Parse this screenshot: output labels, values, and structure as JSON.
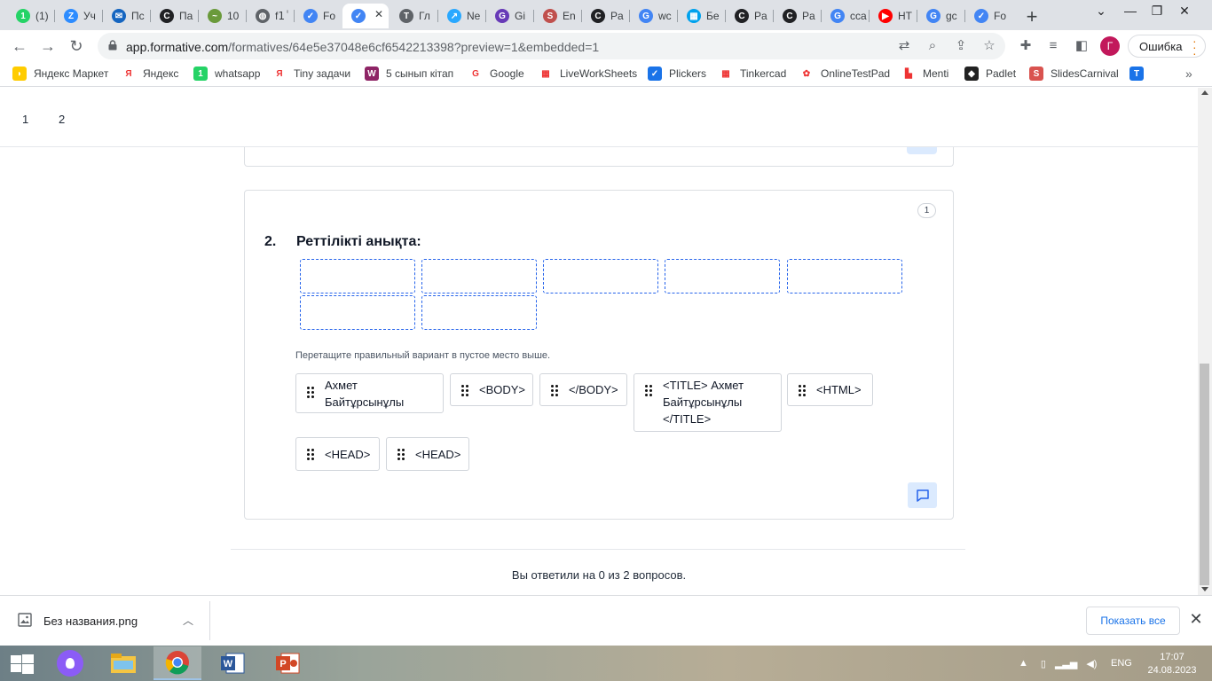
{
  "colors": {
    "accent": "#2563eb",
    "comment_bg": "#dbeafe",
    "profile": "#c2185b",
    "error_dots": "#e37400",
    "show_all": "#1a73e8"
  },
  "tabs": [
    {
      "label": "(1)",
      "icon": "whatsapp-icon",
      "color": "#25d366",
      "glyph": "1"
    },
    {
      "label": "Уч",
      "icon": "zoom-icon",
      "color": "#2d8cff",
      "glyph": "Z"
    },
    {
      "label": "Пс",
      "icon": "mail-icon",
      "color": "#1565c0",
      "glyph": "✉"
    },
    {
      "label": "Па",
      "icon": "padlet-icon",
      "color": "#202124",
      "glyph": "C"
    },
    {
      "label": "10",
      "icon": "site-icon",
      "color": "#6a9a3b",
      "glyph": "~"
    },
    {
      "label": "f1ٰ",
      "icon": "globe-icon",
      "color": "#5f6368",
      "glyph": "◍"
    },
    {
      "label": "Fo",
      "icon": "formative-icon",
      "color": "#4285f4",
      "glyph": "✓"
    },
    {
      "label": "",
      "icon": "formative-icon",
      "color": "#4285f4",
      "glyph": "✓",
      "active": true
    },
    {
      "label": "Гл",
      "icon": "site-icon",
      "color": "#5f6368",
      "glyph": "T"
    },
    {
      "label": "Ne",
      "icon": "site-icon",
      "color": "#29a8ff",
      "glyph": "↗"
    },
    {
      "label": "Gi",
      "icon": "site-icon",
      "color": "#673ab7",
      "glyph": "G"
    },
    {
      "label": "En",
      "icon": "site-icon",
      "color": "#c0504d",
      "glyph": "S"
    },
    {
      "label": "Pa",
      "icon": "padlet-icon",
      "color": "#202124",
      "glyph": "C"
    },
    {
      "label": "wc",
      "icon": "google-icon",
      "color": "#4285f4",
      "glyph": "G"
    },
    {
      "label": "Бе",
      "icon": "site-icon",
      "color": "#00a2ed",
      "glyph": "▦"
    },
    {
      "label": "Pa",
      "icon": "padlet-icon",
      "color": "#202124",
      "glyph": "C"
    },
    {
      "label": "Pa",
      "icon": "padlet-icon",
      "color": "#202124",
      "glyph": "C"
    },
    {
      "label": "cca",
      "icon": "google-icon",
      "color": "#4285f4",
      "glyph": "G"
    },
    {
      "label": "НТ",
      "icon": "youtube-icon",
      "color": "#ff0000",
      "glyph": "▶"
    },
    {
      "label": "gc",
      "icon": "google-icon",
      "color": "#4285f4",
      "glyph": "G"
    },
    {
      "label": "Fo",
      "icon": "formative-icon",
      "color": "#4285f4",
      "glyph": "✓"
    }
  ],
  "toolbar": {
    "url_host": "app.formative.com",
    "url_rest": "/formatives/64e5e37048e6cf6542213398?preview=1&embedded=1",
    "profile_initial": "Г",
    "error_label": "Ошибка"
  },
  "bookmarks": [
    {
      "label": "Яндекс Маркет",
      "icon": "yandex-market-icon",
      "color": "#fc0",
      "glyph": "◗"
    },
    {
      "label": "Яндекс",
      "icon": "yandex-icon",
      "color": "#fff",
      "glyph": "Я"
    },
    {
      "label": "whatsapp",
      "icon": "whatsapp-icon",
      "color": "#25d366",
      "glyph": "1"
    },
    {
      "label": "Tiny задачи",
      "icon": "yandex-icon",
      "color": "#fff",
      "glyph": "Я"
    },
    {
      "label": "5 сынып кітап",
      "icon": "book-icon",
      "color": "#8e2465",
      "glyph": "W"
    },
    {
      "label": "Google",
      "icon": "google-icon",
      "color": "#fff",
      "glyph": "G"
    },
    {
      "label": "LiveWorkSheets",
      "icon": "liveworksheets-icon",
      "color": "#fff",
      "glyph": "▦"
    },
    {
      "label": "Plickers",
      "icon": "plickers-icon",
      "color": "#1a73e8",
      "glyph": "✓"
    },
    {
      "label": "Tinkercad",
      "icon": "tinkercad-icon",
      "color": "#fff",
      "glyph": "▦"
    },
    {
      "label": "OnlineTestPad",
      "icon": "onlinetestpad-icon",
      "color": "#fff",
      "glyph": "✿"
    },
    {
      "label": "Menti",
      "icon": "menti-icon",
      "color": "#fff",
      "glyph": "▙"
    },
    {
      "label": "Padlet",
      "icon": "padlet-icon",
      "color": "#222",
      "glyph": "◆"
    },
    {
      "label": "SlidesCarnival",
      "icon": "slidescarnival-icon",
      "color": "#d9534f",
      "glyph": "S"
    },
    {
      "label": "",
      "icon": "translate-icon",
      "color": "#1a73e8",
      "glyph": "T"
    }
  ],
  "pager": [
    "1",
    "2"
  ],
  "question": {
    "number": "2.",
    "title": "Реттілікті анықта:",
    "points": "1",
    "hint": "Перетащите правильный вариант в пустое место выше.",
    "choices": [
      "Ахмет Байтұрсынұлы",
      "<BODY>",
      "</BODY>",
      "<TITLE> Ахмет Байтұрсынұлы </TITLE>",
      "<HTML>",
      "<HEAD>",
      "<HEAD>"
    ]
  },
  "footer": {
    "answered_text": "Вы ответили на 0 из 2 вопросов."
  },
  "download": {
    "file_name": "Без названия.png",
    "show_all": "Показать все"
  },
  "taskbar": {
    "language": "ENG",
    "time": "17:07",
    "date": "24.08.2023"
  }
}
